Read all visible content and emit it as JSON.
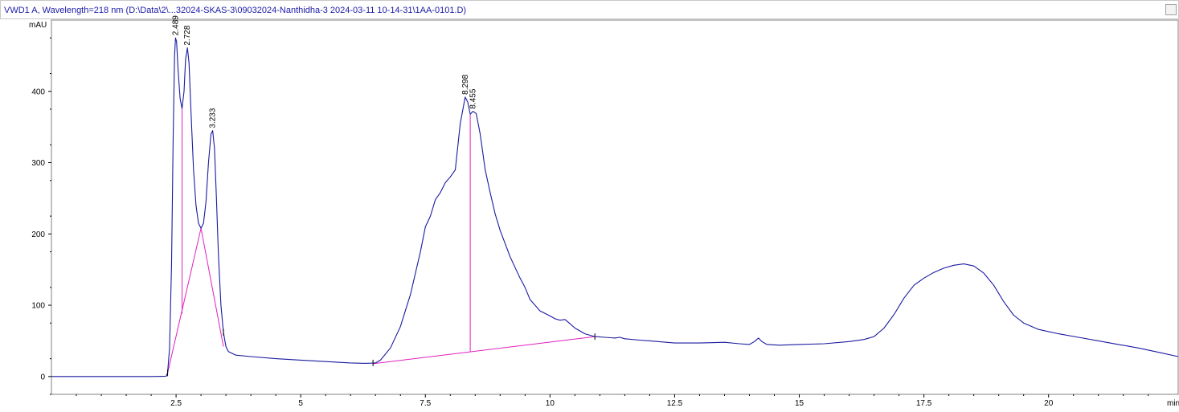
{
  "window": {
    "title": "VWD1 A, Wavelength=218 nm (D:\\Data\\2\\...32024-SKAS-3\\09032024-Nanthidha-3 2024-03-11 10-14-31\\1AA-0101.D)"
  },
  "chart_data": {
    "type": "line",
    "title": "VWD1 A, Wavelength=218 nm (D:\\Data\\2\\...32024-SKAS-3\\09032024-Nanthidha-3 2024-03-11 10-14-31\\1AA-0101.D)",
    "xlabel": "min",
    "ylabel": "mAU",
    "xlim": [
      0,
      22.6
    ],
    "ylim": [
      -25,
      500
    ],
    "x_ticks": [
      {
        "value": 2.5,
        "label": "2.5"
      },
      {
        "value": 5,
        "label": "5"
      },
      {
        "value": 7.5,
        "label": "7.5"
      },
      {
        "value": 10,
        "label": "10"
      },
      {
        "value": 12.5,
        "label": "12.5"
      },
      {
        "value": 15,
        "label": "15"
      },
      {
        "value": 17.5,
        "label": "17.5"
      },
      {
        "value": 20,
        "label": "20"
      }
    ],
    "y_ticks": [
      {
        "value": 0,
        "label": "0"
      },
      {
        "value": 100,
        "label": "100"
      },
      {
        "value": 200,
        "label": "200"
      },
      {
        "value": 300,
        "label": "300"
      },
      {
        "value": 400,
        "label": "400"
      }
    ],
    "series": [
      {
        "color": "#1a1aa0",
        "points": [
          [
            0,
            0
          ],
          [
            1.0,
            0
          ],
          [
            2.0,
            0
          ],
          [
            2.3,
            0.5
          ],
          [
            2.33,
            5
          ],
          [
            2.37,
            40
          ],
          [
            2.41,
            160
          ],
          [
            2.44,
            330
          ],
          [
            2.47,
            450
          ],
          [
            2.489,
            475
          ],
          [
            2.51,
            470
          ],
          [
            2.54,
            430
          ],
          [
            2.58,
            390
          ],
          [
            2.62,
            376
          ],
          [
            2.66,
            400
          ],
          [
            2.69,
            445
          ],
          [
            2.728,
            461
          ],
          [
            2.76,
            440
          ],
          [
            2.8,
            370
          ],
          [
            2.85,
            290
          ],
          [
            2.9,
            240
          ],
          [
            2.95,
            215
          ],
          [
            3.0,
            208
          ],
          [
            3.05,
            215
          ],
          [
            3.1,
            245
          ],
          [
            3.15,
            300
          ],
          [
            3.2,
            340
          ],
          [
            3.233,
            345
          ],
          [
            3.27,
            320
          ],
          [
            3.31,
            250
          ],
          [
            3.35,
            170
          ],
          [
            3.4,
            100
          ],
          [
            3.45,
            62
          ],
          [
            3.5,
            42
          ],
          [
            3.55,
            35
          ],
          [
            3.7,
            30
          ],
          [
            4.0,
            28
          ],
          [
            4.5,
            25
          ],
          [
            5.0,
            23
          ],
          [
            5.5,
            21
          ],
          [
            6.0,
            19
          ],
          [
            6.3,
            18.5
          ],
          [
            6.5,
            19
          ],
          [
            6.6,
            23
          ],
          [
            6.8,
            40
          ],
          [
            7.0,
            70
          ],
          [
            7.2,
            115
          ],
          [
            7.4,
            175
          ],
          [
            7.5,
            210
          ],
          [
            7.6,
            225
          ],
          [
            7.7,
            248
          ],
          [
            7.8,
            258
          ],
          [
            7.9,
            272
          ],
          [
            8.0,
            280
          ],
          [
            8.1,
            290
          ],
          [
            8.2,
            355
          ],
          [
            8.298,
            392
          ],
          [
            8.35,
            385
          ],
          [
            8.4,
            368
          ],
          [
            8.455,
            372
          ],
          [
            8.52,
            369
          ],
          [
            8.6,
            340
          ],
          [
            8.7,
            290
          ],
          [
            8.8,
            258
          ],
          [
            8.9,
            228
          ],
          [
            9.0,
            205
          ],
          [
            9.2,
            168
          ],
          [
            9.4,
            138
          ],
          [
            9.5,
            125
          ],
          [
            9.6,
            108
          ],
          [
            9.8,
            92
          ],
          [
            10.0,
            85
          ],
          [
            10.1,
            81
          ],
          [
            10.2,
            79
          ],
          [
            10.3,
            80
          ],
          [
            10.4,
            74
          ],
          [
            10.5,
            68
          ],
          [
            10.7,
            60
          ],
          [
            10.9,
            56
          ],
          [
            11.1,
            55
          ],
          [
            11.3,
            54
          ],
          [
            11.4,
            55
          ],
          [
            11.5,
            53
          ],
          [
            11.8,
            51
          ],
          [
            12.0,
            50
          ],
          [
            12.5,
            47
          ],
          [
            13.0,
            47
          ],
          [
            13.5,
            48
          ],
          [
            13.8,
            46
          ],
          [
            14.0,
            45
          ],
          [
            14.1,
            49
          ],
          [
            14.18,
            54
          ],
          [
            14.25,
            49
          ],
          [
            14.35,
            45
          ],
          [
            14.6,
            44
          ],
          [
            15.0,
            45
          ],
          [
            15.5,
            46
          ],
          [
            16.0,
            49
          ],
          [
            16.3,
            52
          ],
          [
            16.5,
            56
          ],
          [
            16.7,
            68
          ],
          [
            16.9,
            87
          ],
          [
            17.1,
            110
          ],
          [
            17.3,
            128
          ],
          [
            17.5,
            138
          ],
          [
            17.7,
            146
          ],
          [
            17.9,
            152
          ],
          [
            18.1,
            156
          ],
          [
            18.3,
            158
          ],
          [
            18.5,
            155
          ],
          [
            18.7,
            145
          ],
          [
            18.9,
            128
          ],
          [
            19.1,
            105
          ],
          [
            19.3,
            86
          ],
          [
            19.5,
            75
          ],
          [
            19.8,
            66
          ],
          [
            20.2,
            60
          ],
          [
            20.6,
            55
          ],
          [
            21.0,
            50
          ],
          [
            21.4,
            45
          ],
          [
            21.8,
            40
          ],
          [
            22.2,
            34
          ],
          [
            22.6,
            28
          ]
        ]
      }
    ],
    "peaks": [
      {
        "rt": 2.489,
        "label": "2.489",
        "apex": 475
      },
      {
        "rt": 2.728,
        "label": "2.728",
        "apex": 461
      },
      {
        "rt": 3.233,
        "label": "3.233",
        "apex": 345
      },
      {
        "rt": 8.298,
        "label": "8.298",
        "apex": 392
      },
      {
        "rt": 8.455,
        "label": "8.455",
        "apex": 372
      }
    ],
    "integration_color": "#e020c0",
    "baselines": [
      {
        "points": [
          [
            2.33,
            5
          ],
          [
            3.0,
            208
          ]
        ]
      },
      {
        "points": [
          [
            3.0,
            208
          ],
          [
            3.45,
            42
          ]
        ]
      },
      {
        "points": [
          [
            6.45,
            18
          ],
          [
            10.9,
            56
          ]
        ]
      }
    ],
    "drops": [
      {
        "x": 2.62,
        "y_top": 376,
        "y_bottom": 88
      },
      {
        "x": 8.4,
        "y_top": 368,
        "y_bottom": 35
      }
    ],
    "event_ticks": [
      2.33,
      3.45,
      6.45,
      10.9
    ]
  }
}
